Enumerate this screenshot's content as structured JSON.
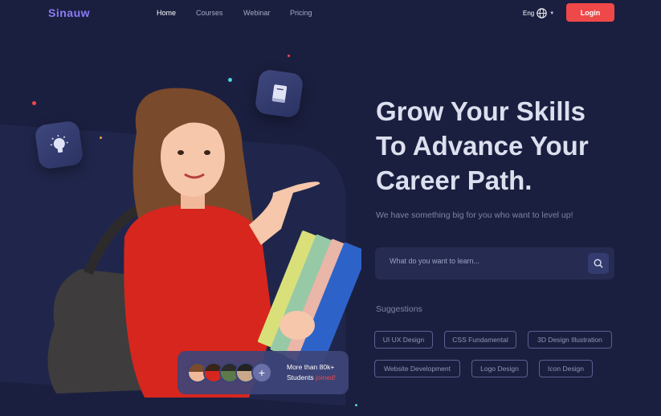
{
  "nav": {
    "logo": "Sinauw",
    "items": [
      {
        "label": "Home",
        "active": true
      },
      {
        "label": "Courses",
        "active": false
      },
      {
        "label": "Webinar",
        "active": false
      },
      {
        "label": "Pricing",
        "active": false
      }
    ],
    "language": "Eng",
    "language_icon": "globe-icon",
    "login_label": "Login"
  },
  "hero": {
    "headline_lines": [
      "Grow Your Skills",
      "To Advance Your",
      "Career Path."
    ],
    "subtitle": "We have something big for you who want to level up!",
    "search_placeholder": "What do you want to learn...",
    "search_icon": "search-icon",
    "suggestions_title": "Suggestions",
    "suggestions": [
      "UI UX Design",
      "CSS Fundamental",
      "3D Design Illustration",
      "Website Development",
      "Logo Design",
      "Icon Design"
    ]
  },
  "stats": {
    "line1": "More than 80k+",
    "line2_prefix": "Students ",
    "line2_highlight": "joined!",
    "avatars": [
      "avatar-1",
      "avatar-2",
      "avatar-3",
      "avatar-4"
    ],
    "plus_icon": "plus-icon"
  },
  "decor": {
    "float_icons": [
      "lightbulb-icon",
      "book-icon"
    ]
  },
  "colors": {
    "background": "#1b1f3f",
    "accent": "#ef4848",
    "brand": "#8b7cf6"
  }
}
